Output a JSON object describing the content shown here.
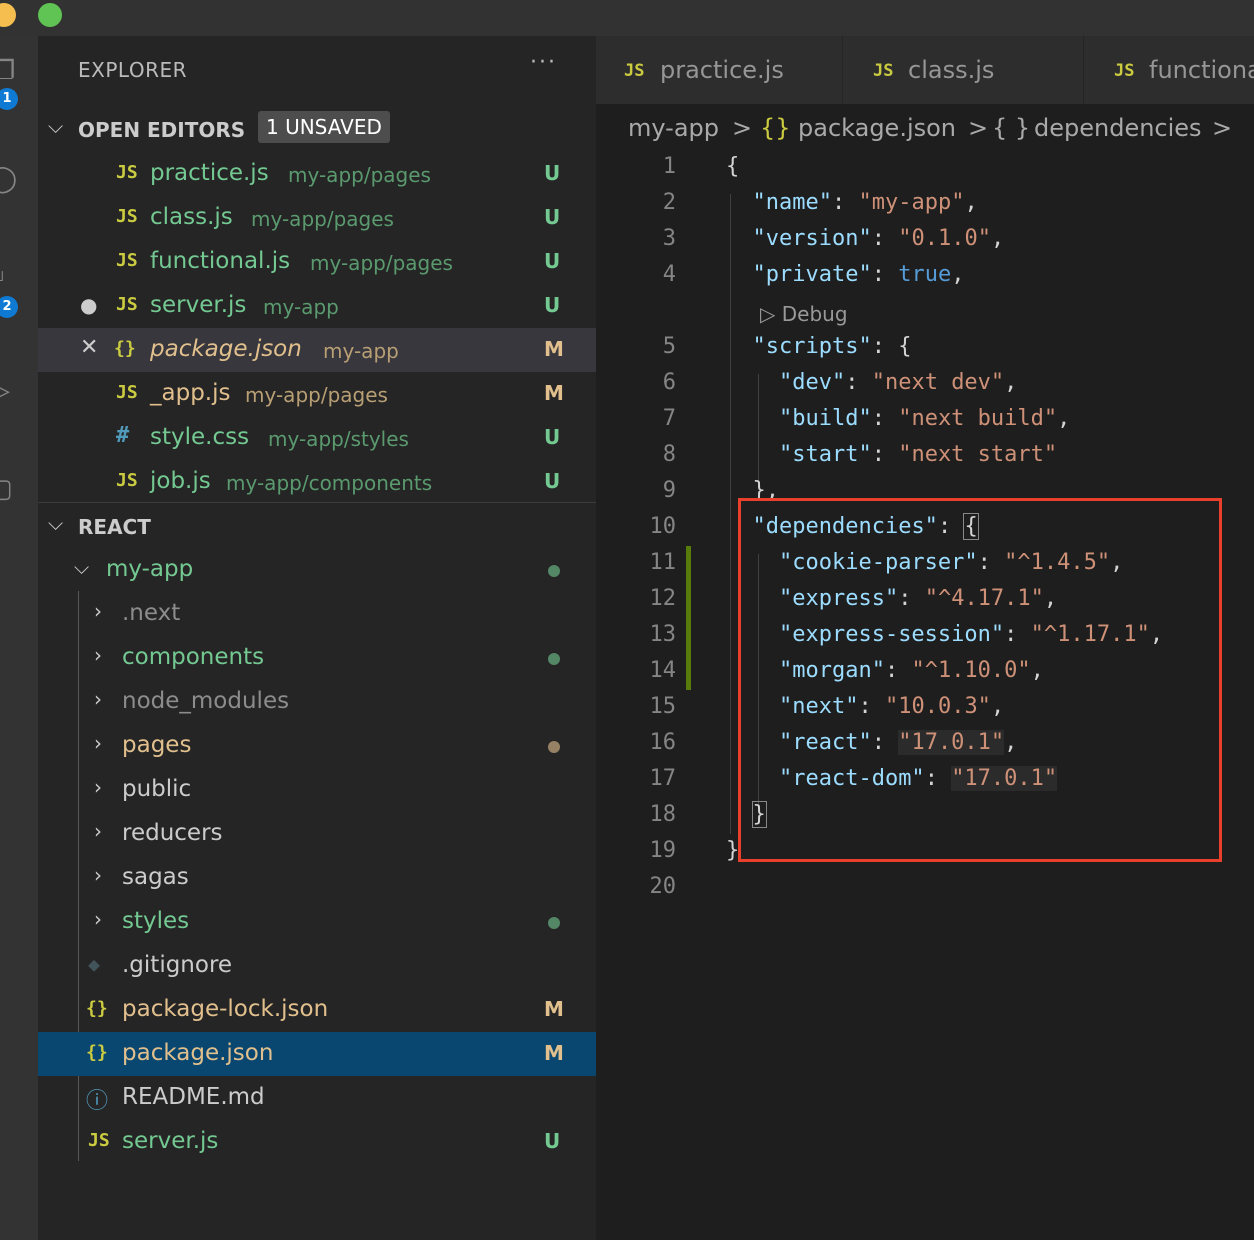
{
  "colors": {
    "accent": "#094771",
    "modified": "#e2c08d",
    "untracked": "#73c991",
    "annotation_box": "#e8402c"
  },
  "explorer": {
    "title": "EXPLORER",
    "more": "···",
    "open_editors": {
      "title": "OPEN EDITORS",
      "badge": "1 UNSAVED",
      "items": [
        {
          "icon": "JS",
          "name": "practice.js",
          "path": "my-app/pages",
          "status": "U"
        },
        {
          "icon": "JS",
          "name": "class.js",
          "path": "my-app/pages",
          "status": "U"
        },
        {
          "icon": "JS",
          "name": "functional.js",
          "path": "my-app/pages",
          "status": "U"
        },
        {
          "icon": "JS",
          "name": "server.js",
          "path": "my-app",
          "status": "U",
          "lead": "●"
        },
        {
          "icon": "{}",
          "name": "package.json",
          "path": "my-app",
          "status": "M",
          "lead": "✕"
        },
        {
          "icon": "JS",
          "name": "_app.js",
          "path": "my-app/pages",
          "status": "M"
        },
        {
          "icon": "#",
          "name": "style.css",
          "path": "my-app/styles",
          "status": "U"
        },
        {
          "icon": "JS",
          "name": "job.js",
          "path": "my-app/components",
          "status": "U"
        }
      ]
    },
    "react": {
      "title": "REACT",
      "root": "my-app",
      "folders": [
        ".next",
        "components",
        "node_modules",
        "pages",
        "public",
        "reducers",
        "sagas",
        "styles"
      ],
      "files": [
        {
          "icon": "◆",
          "name": ".gitignore",
          "status": ""
        },
        {
          "icon": "{}",
          "name": "package-lock.json",
          "status": "M"
        },
        {
          "icon": "{}",
          "name": "package.json",
          "status": "M"
        },
        {
          "icon": "ⓘ",
          "name": "README.md",
          "status": ""
        },
        {
          "icon": "JS",
          "name": "server.js",
          "status": "U"
        }
      ]
    }
  },
  "activity": {
    "badge1": "1",
    "badge2": "2"
  },
  "tabs": [
    {
      "icon": "JS",
      "label": "practice.js"
    },
    {
      "icon": "JS",
      "label": "class.js"
    },
    {
      "icon": "JS",
      "label": "functional.js"
    }
  ],
  "breadcrumb": {
    "folder": "my-app",
    "sep": ">",
    "file_icon": "{}",
    "file": "package.json",
    "symbol_icon": "{ }",
    "symbol": "dependencies"
  },
  "editor": {
    "codelens": "▷ Debug",
    "lines": {
      "l1": "1",
      "l2": "2",
      "l3": "3",
      "l4": "4",
      "l5": "5",
      "l6": "6",
      "l7": "7",
      "l8": "8",
      "l9": "9",
      "l10": "10",
      "l11": "11",
      "l12": "12",
      "l13": "13",
      "l14": "14",
      "l15": "15",
      "l16": "16",
      "l17": "17",
      "l18": "18",
      "l19": "19",
      "l20": "20"
    },
    "code": {
      "open_brace": "{",
      "name_key": "\"name\"",
      "name_val": "\"my-app\"",
      "version_key": "\"version\"",
      "version_val": "\"0.1.0\"",
      "private_key": "\"private\"",
      "private_val": "true",
      "scripts_key": "\"scripts\"",
      "dev_key": "\"dev\"",
      "dev_val": "\"next dev\"",
      "build_key": "\"build\"",
      "build_val": "\"next build\"",
      "start_key": "\"start\"",
      "start_val": "\"next start\"",
      "close_scripts": "},",
      "deps_key": "\"dependencies\"",
      "cookie_key": "\"cookie-parser\"",
      "cookie_val": "\"^1.4.5\"",
      "express_key": "\"express\"",
      "express_val": "\"^4.17.1\"",
      "session_key": "\"express-session\"",
      "session_val": "\"^1.17.1\"",
      "morgan_key": "\"morgan\"",
      "morgan_val": "\"^1.10.0\"",
      "next_key": "\"next\"",
      "next_val": "\"10.0.3\"",
      "react_key": "\"react\"",
      "react_val": "\"17.0.1\"",
      "reactdom_key": "\"react-dom\"",
      "reactdom_val": "\"17.0.1\"",
      "close_deps": "}",
      "close_root": "}"
    }
  }
}
